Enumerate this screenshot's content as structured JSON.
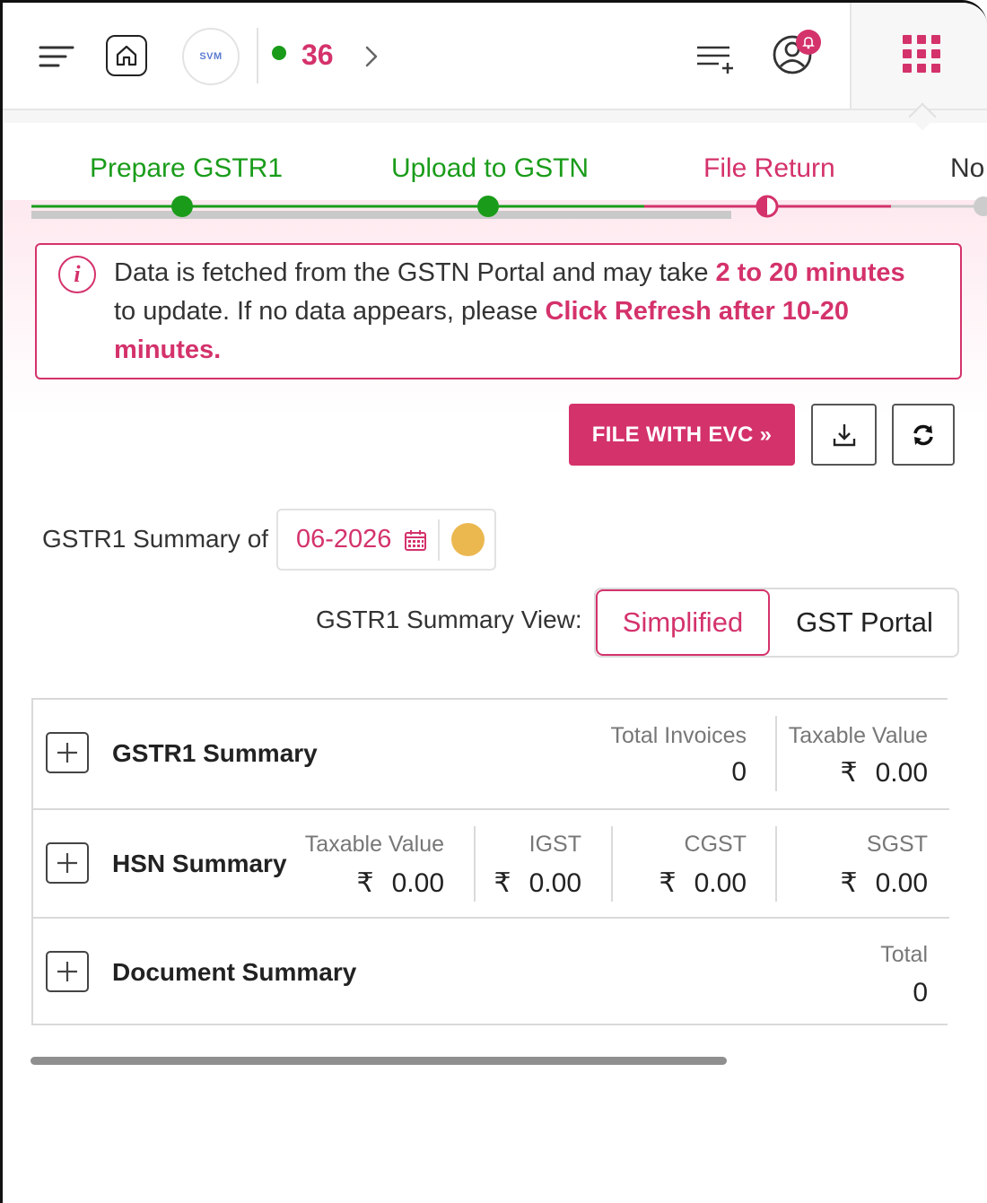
{
  "header": {
    "notification_count": "36",
    "logo_text": "SVM"
  },
  "stepper": {
    "steps": [
      {
        "label": "Prepare GSTR1",
        "state": "done"
      },
      {
        "label": "Upload to GSTN",
        "state": "done"
      },
      {
        "label": "File Return",
        "state": "current"
      },
      {
        "label": "No",
        "state": "pending"
      }
    ]
  },
  "info": {
    "line1_prefix": "Data is fetched from the GSTN Portal and may take ",
    "line1_highlight": "2 to 20 minutes",
    "line2_prefix": "to update. If no data appears, please ",
    "line2_highlight": "Click Refresh after 10-20 minutes."
  },
  "actions": {
    "file_with_evc": "FILE WITH EVC »",
    "download_icon": "download-icon",
    "refresh_icon": "refresh-icon"
  },
  "period": {
    "label": "GSTR1 Summary of",
    "value": "06-2026"
  },
  "view": {
    "label": "GSTR1 Summary View:",
    "options": [
      "Simplified",
      "GST Portal"
    ],
    "selected": "Simplified"
  },
  "summary": {
    "gstr1": {
      "title": "GSTR1 Summary",
      "total_invoices_label": "Total Invoices",
      "total_invoices_value": "0",
      "taxable_value_label": "Taxable Value",
      "taxable_value": "0.00"
    },
    "hsn": {
      "title": "HSN Summary",
      "taxable_value_label": "Taxable Value",
      "taxable_value": "0.00",
      "igst_label": "IGST",
      "igst_value": "0.00",
      "cgst_label": "CGST",
      "cgst_value": "0.00",
      "sgst_label": "SGST",
      "sgst_value": "0.00"
    },
    "document": {
      "title": "Document Summary",
      "total_label": "Total",
      "total_value": "0"
    },
    "currency_symbol": "₹"
  },
  "colors": {
    "accent": "#d4326b",
    "done": "#1a9c1a",
    "pending": "#cccccc"
  }
}
